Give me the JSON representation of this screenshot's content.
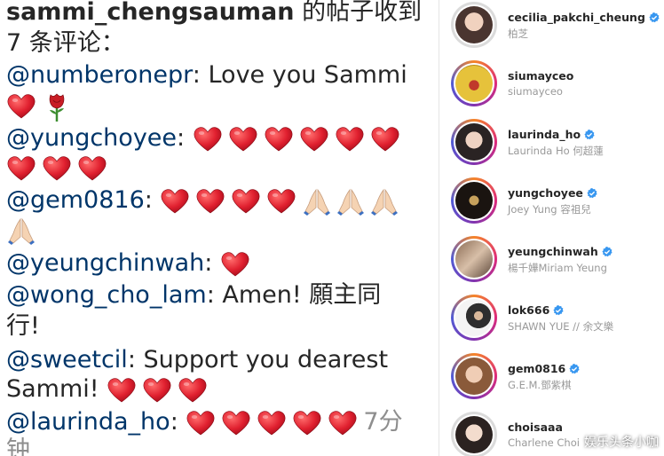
{
  "notification": {
    "username": "sammi_chengsauman",
    "header_suffix": " 的帖子收到",
    "header_line2": "7 条评论：",
    "comments": [
      {
        "user": "@numberonepr",
        "text": ": Love you Sammi"
      },
      {
        "user": "@yungchoyee",
        "text": ":"
      },
      {
        "user": "@gem0816",
        "text": ":"
      },
      {
        "user": "@yeungchinwah",
        "text": ":"
      },
      {
        "user": "@wong_cho_lam",
        "text": ": Amen! 願主同",
        "text2": "行!"
      },
      {
        "user": "@sweetcil",
        "text": ": Support you dearest",
        "text2": "Sammi!"
      },
      {
        "user": "@laurinda_ho",
        "text": ":",
        "time": "7分",
        "time2": "钟"
      }
    ]
  },
  "accounts": [
    {
      "name": "cecilia_pakchi_cheung",
      "sub": "柏芝",
      "verified": true
    },
    {
      "name": "siumayceo",
      "sub": "siumayceo",
      "verified": false
    },
    {
      "name": "laurinda_ho",
      "sub": "Laurinda Ho 何超蓮",
      "verified": true
    },
    {
      "name": "yungchoyee",
      "sub": "Joey Yung 容祖兒",
      "verified": true
    },
    {
      "name": "yeungchinwah",
      "sub": "楊千嬅Miriam Yeung",
      "verified": true
    },
    {
      "name": "lok666",
      "sub": "SHAWN YUE // 余文樂",
      "verified": true
    },
    {
      "name": "gem0816",
      "sub": "G.E.M.鄧紫棋",
      "verified": true
    },
    {
      "name": "choisaaa",
      "sub": "Charlene Choi",
      "verified": false
    }
  ],
  "watermark": "娱乐头条小咖",
  "colors": {
    "username": "#003569",
    "heart": "#e0245e",
    "verified": "#3897f0",
    "story_ring": [
      "#f58529",
      "#dd2a7b",
      "#8134af"
    ]
  },
  "icons": [
    "heart-icon",
    "rose-icon",
    "praying-hands-icon",
    "verified-badge-icon"
  ]
}
